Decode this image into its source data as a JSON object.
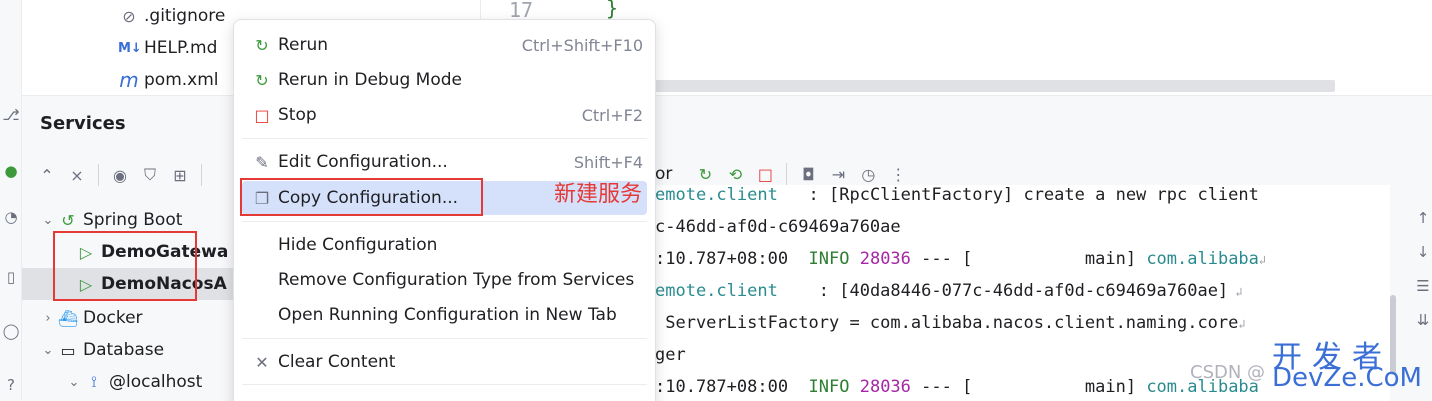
{
  "project_tree": {
    "files": [
      {
        "name": ".gitignore",
        "icon": "ignore-icon"
      },
      {
        "name": "HELP.md",
        "icon": "markdown-icon",
        "icon_text": "M↓"
      },
      {
        "name": "pom.xml",
        "icon": "maven-icon",
        "icon_text": "m"
      }
    ]
  },
  "editor": {
    "line_number": "17",
    "code": "}"
  },
  "services": {
    "title": "Services",
    "tree": [
      {
        "label": "Spring Boot",
        "icon": "spring-boot-icon",
        "chevron": "down"
      },
      {
        "label": "DemoGatewa",
        "icon": "run-icon",
        "selected": false
      },
      {
        "label": "DemoNacosA",
        "icon": "run-icon",
        "selected": true
      },
      {
        "label": "Docker",
        "icon": "docker-icon",
        "chevron": "right"
      },
      {
        "label": "Database",
        "icon": "folder-icon",
        "chevron": "down"
      },
      {
        "label": "@localhost",
        "icon": "datasource-icon",
        "chevron": "down"
      }
    ]
  },
  "console": {
    "toolbar_label": "or",
    "lines": [
      {
        "parts": [
          {
            "t": "emote.client",
            "c": "teal"
          },
          {
            "t": "   : [RpcClientFactory] create a new rpc client",
            "c": "muted"
          }
        ]
      },
      {
        "parts": [
          {
            "t": "c-46dd-af0d-c69469a760ae",
            "c": "plain"
          }
        ]
      },
      {
        "parts": [
          {
            "t": ":10.787+08:00  ",
            "c": "plain"
          },
          {
            "t": "INFO ",
            "c": "green"
          },
          {
            "t": "28036",
            "c": "purple"
          },
          {
            "t": " --- [           main] ",
            "c": "plain"
          },
          {
            "t": "com.alibaba",
            "c": "teal"
          }
        ]
      },
      {
        "parts": [
          {
            "t": "emote.client",
            "c": "teal"
          },
          {
            "t": "    : [40da8446-077c-46dd-af0d-c69469a760ae]",
            "c": "plain"
          }
        ]
      },
      {
        "parts": [
          {
            "t": " ServerListFactory = com.alibaba.nacos.client.naming.core",
            "c": "plain"
          }
        ]
      },
      {
        "parts": [
          {
            "t": "ger",
            "c": "plain"
          }
        ]
      },
      {
        "parts": [
          {
            "t": ":10.787+08:00  ",
            "c": "plain"
          },
          {
            "t": "INFO ",
            "c": "green"
          },
          {
            "t": "28036",
            "c": "purple"
          },
          {
            "t": " --- [           main] ",
            "c": "plain"
          },
          {
            "t": "com.alibaba",
            "c": "teal"
          }
        ]
      }
    ]
  },
  "context_menu": {
    "items": [
      {
        "label": "Rerun",
        "shortcut": "Ctrl+Shift+F10",
        "icon": "rerun-icon",
        "glyph": "↻"
      },
      {
        "label": "Rerun in Debug Mode",
        "shortcut": "",
        "icon": "rerun-debug-icon",
        "glyph": "↻"
      },
      {
        "label": "Stop",
        "shortcut": "Ctrl+F2",
        "icon": "stop-icon",
        "glyph": "□"
      },
      {
        "label": "Edit Configuration...",
        "shortcut": "Shift+F4",
        "icon": "edit-icon",
        "glyph": "✎"
      },
      {
        "label": "Copy Configuration...",
        "shortcut": "",
        "icon": "copy-icon",
        "glyph": "❐"
      },
      {
        "label": "Hide Configuration",
        "shortcut": "",
        "icon": "",
        "glyph": ""
      },
      {
        "label": "Remove Configuration Type from Services",
        "shortcut": "",
        "icon": "",
        "glyph": ""
      },
      {
        "label": "Open Running Configuration in New Tab",
        "shortcut": "",
        "icon": "",
        "glyph": ""
      },
      {
        "label": "Clear Content",
        "shortcut": "",
        "icon": "clear-icon",
        "glyph": "✕"
      }
    ]
  },
  "annotation": {
    "note": "新建服务"
  },
  "watermark": {
    "csdn": "CSDN @",
    "cn": "开发者",
    "en": "DevZe.CoM"
  },
  "colors": {
    "accent_highlight": "#d5e1fb",
    "annotation_red": "#e53935",
    "run_green": "#3c9a3c",
    "stop_red": "#e53935",
    "log_info_green": "#2e7d32",
    "log_pid_purple": "#a626a4",
    "log_logger_teal": "#2a8b8f"
  }
}
